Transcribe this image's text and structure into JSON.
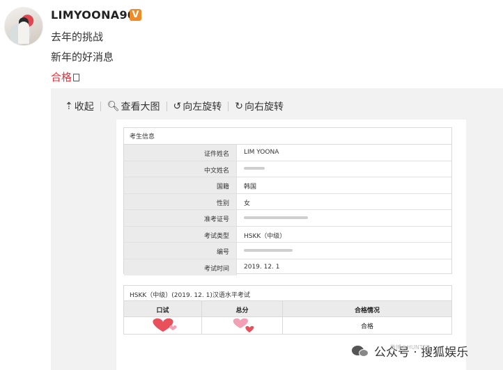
{
  "post": {
    "username": "LIMYOONA90",
    "verified_badge": "V",
    "lines": [
      "去年的挑战",
      "新年的好消息",
      "合格"
    ]
  },
  "toolbar": {
    "collapse": {
      "icon": "collapse-up-icon",
      "label": "收起"
    },
    "view_large": {
      "icon": "magnifier-icon",
      "label": "查看大图"
    },
    "rotate_left": {
      "icon": "rotate-left-icon",
      "label": "向左旋转"
    },
    "rotate_right": {
      "icon": "rotate-right-icon",
      "label": "向右旋转"
    }
  },
  "document": {
    "candidate_section_title": "考生信息",
    "rows": [
      {
        "label": "证件姓名",
        "value": "LIM YOONA"
      },
      {
        "label": "中文姓名",
        "value": ""
      },
      {
        "label": "国籍",
        "value": "韩国"
      },
      {
        "label": "性别",
        "value": "女"
      },
      {
        "label": "准考证号",
        "value": ""
      },
      {
        "label": "考试类型",
        "value": "HSKK（中级）"
      },
      {
        "label": "编号",
        "value": ""
      },
      {
        "label": "考试时间",
        "value": "2019. 12. 1"
      }
    ],
    "result_section_title": "HSKK（中级）(2019. 12. 1)汉语水平考试",
    "result_headers": [
      "口试",
      "总分",
      "合格情况"
    ],
    "result_values": [
      "",
      "",
      "合格"
    ]
  },
  "watermark": {
    "text": "公众号 · 搜狐娱乐",
    "faint": "微博@HUNTER"
  },
  "colors": {
    "highlight_red": "#e8323c",
    "verified_orange": "#f08a24",
    "heart_red": "#e8505b",
    "heart_pink": "#f2a0b6"
  }
}
